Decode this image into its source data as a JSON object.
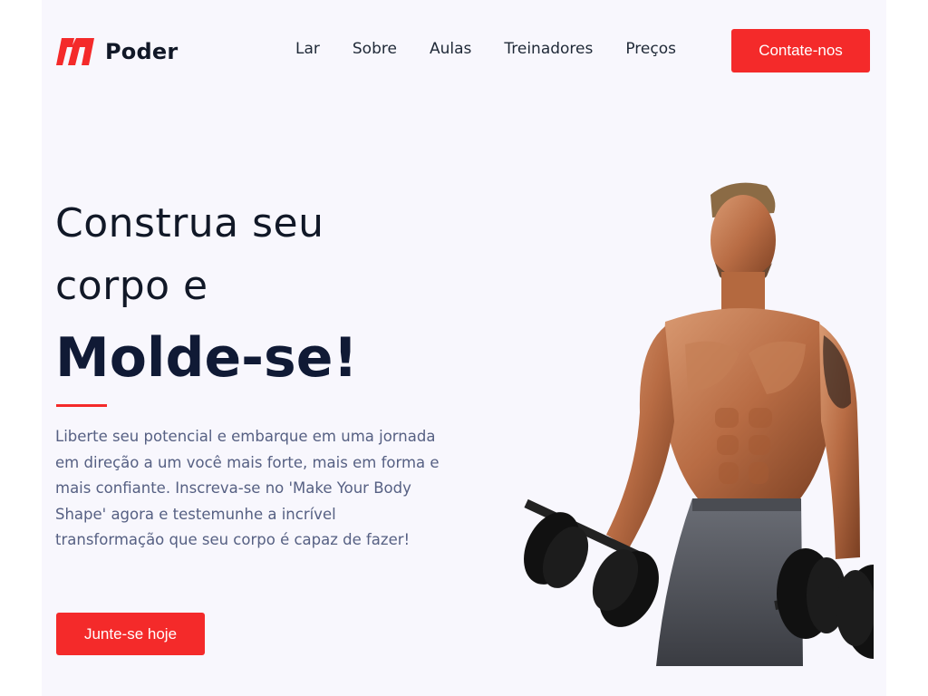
{
  "brand": {
    "name": "Poder",
    "accent": "#f42a2a",
    "logo_letter": "m"
  },
  "nav": {
    "items": [
      "Lar",
      "Sobre",
      "Aulas",
      "Treinadores",
      "Preços"
    ],
    "cta_label": "Contate-nos"
  },
  "hero": {
    "line1": "Construa seu",
    "line2": "corpo e",
    "strong": "Molde-se!",
    "description": "Liberte seu potencial e embarque em uma jornada em direção a um você mais forte, mais em forma e mais confiante. Inscreva-se no 'Make Your Body Shape' agora e testemunhe a incrível transformação que seu corpo é capaz de fazer!",
    "cta_label": "Junte-se hoje"
  },
  "colors": {
    "page_bg": "#f8f7fd",
    "heading": "#101a35",
    "body_text": "#566083"
  }
}
